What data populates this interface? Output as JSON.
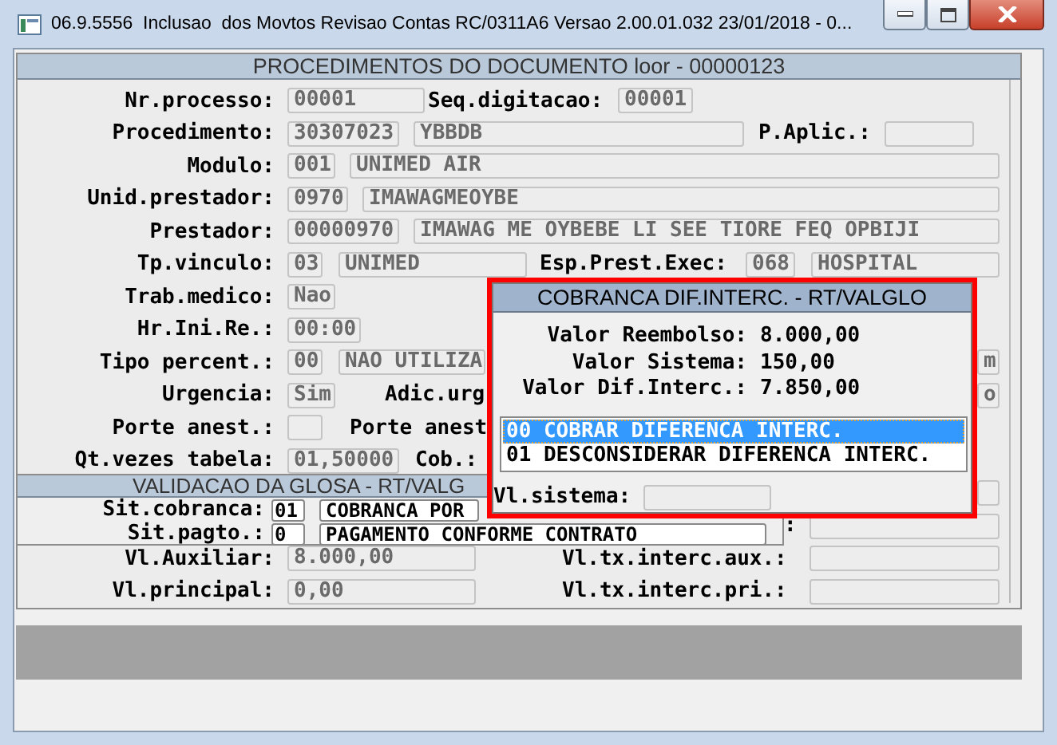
{
  "window": {
    "title": "06.9.5556  Inclusao  dos Movtos Revisao Contas RC/0311A6 Versao 2.00.01.032 23/01/2018 - 0..."
  },
  "form": {
    "title": "PROCEDIMENTOS DO DOCUMENTO loor - 00000123",
    "rows": [
      {
        "label": "Nr.processo:",
        "items": [
          {
            "kind": "field",
            "value": "00001"
          },
          {
            "kind": "label",
            "text": "Seq.digitacao:"
          },
          {
            "kind": "field",
            "value": "00001"
          }
        ]
      },
      {
        "label": "Procedimento:",
        "items": [
          {
            "kind": "field",
            "value": "30307023"
          },
          {
            "kind": "field",
            "value": "YBBDB"
          },
          {
            "kind": "label",
            "text": "P.Aplic.:"
          },
          {
            "kind": "field"
          }
        ]
      },
      {
        "label": "Modulo:",
        "items": [
          {
            "kind": "field",
            "value": "001"
          },
          {
            "kind": "field",
            "value": "UNIMED AIR"
          }
        ]
      },
      {
        "label": "Unid.prestador:",
        "items": [
          {
            "kind": "field",
            "value": "0970"
          },
          {
            "kind": "field",
            "value": "IMAWAGMEOYBE"
          }
        ]
      },
      {
        "label": "Prestador:",
        "items": [
          {
            "kind": "field",
            "value": "00000970"
          },
          {
            "kind": "field",
            "value": "IMAWAG ME OYBEBE LI SEE TIORE FEQ OPBIJI"
          }
        ]
      },
      {
        "label": "Tp.vinculo:",
        "items": [
          {
            "kind": "field",
            "value": "03"
          },
          {
            "kind": "field",
            "value": "UNIMED"
          },
          {
            "kind": "label",
            "text": "Esp.Prest.Exec:"
          },
          {
            "kind": "field",
            "value": "068"
          },
          {
            "kind": "field",
            "value": "HOSPITAL"
          }
        ]
      },
      {
        "label": "Trab.medico:",
        "items": [
          {
            "kind": "field",
            "value": "Nao"
          }
        ]
      },
      {
        "label": "Hr.Ini.Re.:",
        "items": [
          {
            "kind": "field",
            "value": "00:00"
          }
        ]
      },
      {
        "label": "Tipo percent.:",
        "items": [
          {
            "kind": "field",
            "value": "00"
          },
          {
            "kind": "field",
            "value": "NAO UTILIZA"
          },
          {
            "kind": "field",
            "value": "m"
          }
        ]
      },
      {
        "label": "Urgencia:",
        "items": [
          {
            "kind": "field",
            "value": "Sim"
          },
          {
            "kind": "label",
            "text": "Adic.urg"
          },
          {
            "kind": "field",
            "value": "o"
          }
        ]
      },
      {
        "label": "Porte anest.:",
        "items": [
          {
            "kind": "field"
          },
          {
            "kind": "label",
            "text": "Porte anest"
          }
        ]
      },
      {
        "label": "Qt.vezes tabela:",
        "items": [
          {
            "kind": "field",
            "value": "01,50000"
          },
          {
            "kind": "label",
            "text": "Cob.:"
          }
        ]
      },
      {
        "items": [
          {
            "kind": "field"
          }
        ]
      },
      {
        "items": [
          {
            "kind": "label",
            "text": ":"
          },
          {
            "kind": "field"
          }
        ]
      },
      {
        "label": "Vl.Auxiliar:",
        "items": [
          {
            "kind": "field",
            "value": "8.000,00"
          },
          {
            "kind": "label",
            "text": "Vl.tx.interc.aux.:"
          },
          {
            "kind": "field"
          }
        ]
      },
      {
        "label": "Vl.principal:",
        "items": [
          {
            "kind": "field",
            "value": "0,00"
          },
          {
            "kind": "label",
            "text": "Vl.tx.interc.pri.:"
          },
          {
            "kind": "field"
          }
        ]
      }
    ]
  },
  "glosa": {
    "title": "VALIDACAO DA GLOSA - RT/VALG",
    "rows": [
      {
        "label": "Sit.cobranca:",
        "code": "01",
        "description": "COBRANCA POR"
      },
      {
        "label": "Sit.pagto.:",
        "code": "0",
        "description": "PAGAMENTO CONFORME CONTRATO"
      }
    ]
  },
  "dialog": {
    "title": "COBRANCA DIF.INTERC. - RT/VALGLO",
    "values": [
      {
        "label": "Valor Reembolso:",
        "value": "8.000,00"
      },
      {
        "label": "Valor Sistema:",
        "value": "150,00"
      },
      {
        "label": "Valor Dif.Interc.:",
        "value": "7.850,00"
      }
    ],
    "options": [
      {
        "text": "00 COBRAR DIFERENCA INTERC.",
        "selected": true
      },
      {
        "text": "01 DESCONSIDERAR DIFERENCA INTERC.",
        "selected": false
      }
    ],
    "field": {
      "label": "Vl.sistema:"
    }
  }
}
